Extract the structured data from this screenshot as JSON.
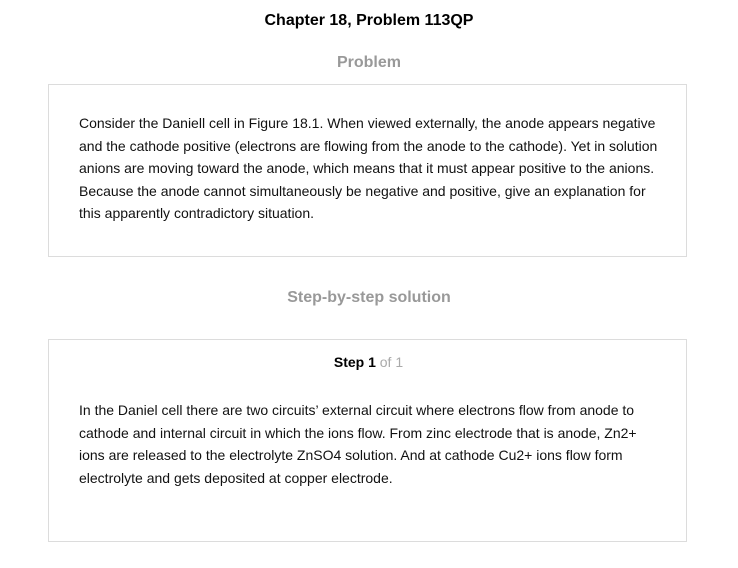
{
  "header": {
    "title": "Chapter 18, Problem 113QP"
  },
  "problem": {
    "heading": "Problem",
    "text": "Consider the Daniell cell in Figure 18.1. When viewed externally, the anode appears negative and the cathode positive (electrons are flowing from the anode to the cathode). Yet in solution anions are moving toward the anode, which means that it must appear positive to the anions. Because the anode cannot simultaneously be negative and positive, give an explanation for this apparently contradictory situation."
  },
  "solution": {
    "heading": "Step-by-step solution",
    "step_label": "Step 1",
    "step_of": "of 1",
    "text": "In the Daniel cell there are two circuits’ external circuit where electrons flow from anode to cathode and internal circuit in which the ions flow. From zinc electrode that is anode, Zn2+ ions are released to the electrolyte ZnSO4 solution. And at cathode Cu2+ ions flow form electrolyte and gets deposited at copper electrode."
  }
}
